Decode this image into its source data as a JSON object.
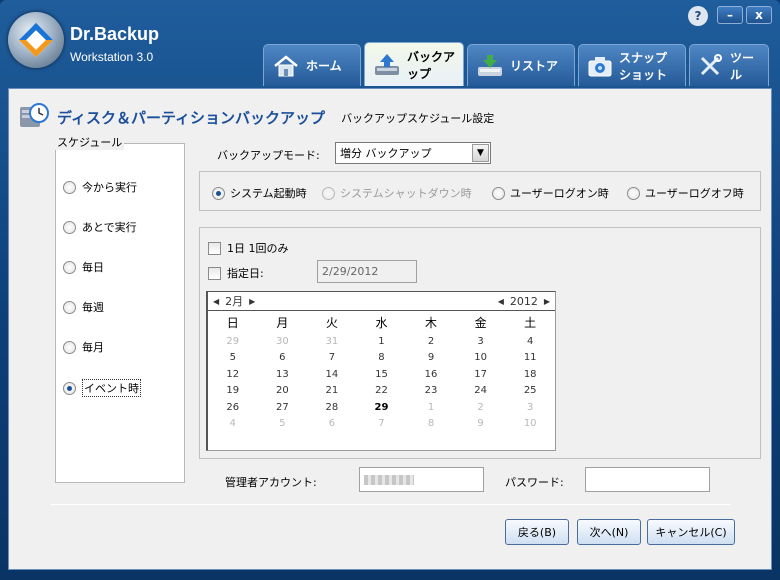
{
  "app": {
    "name": "Dr.Backup",
    "edition": "Workstation 3.0"
  },
  "window_controls": {
    "help": "?",
    "minimize": "–",
    "close": "x"
  },
  "tabs": [
    {
      "label": "ホーム",
      "icon": "house-icon"
    },
    {
      "label": "バックアップ",
      "icon": "backup-upload-icon",
      "active": true
    },
    {
      "label": "リストア",
      "icon": "restore-download-icon"
    },
    {
      "label": "スナップショット",
      "icon": "camera-icon"
    },
    {
      "label": "ツール",
      "icon": "tools-icon"
    }
  ],
  "page": {
    "title": "ディスク＆パーティションバックアップ",
    "subtitle": "バックアップスケジュール設定"
  },
  "schedule": {
    "group_label": "スケジュール",
    "options": [
      "今から実行",
      "あとで実行",
      "毎日",
      "毎週",
      "毎月",
      "イベント時"
    ],
    "selected": "イベント時"
  },
  "backup_mode": {
    "label": "バックアップモード:",
    "value": "増分 バックアップ"
  },
  "events": {
    "options": [
      "システム起動時",
      "システムシャットダウン時",
      "ユーザーログオン時",
      "ユーザーログオフ時"
    ],
    "selected": "システム起動時",
    "disabled": "システムシャットダウン時"
  },
  "date_options": {
    "once_per_day": "1日 1回のみ",
    "specified_date_label": "指定日:",
    "specified_date_value": "2/29/2012"
  },
  "calendar": {
    "month": "2月",
    "year": "2012",
    "weekdays": [
      "日",
      "月",
      "火",
      "水",
      "木",
      "金",
      "土"
    ],
    "weeks": [
      [
        "29",
        "30",
        "31",
        "1",
        "2",
        "3",
        "4"
      ],
      [
        "5",
        "6",
        "7",
        "8",
        "9",
        "10",
        "11"
      ],
      [
        "12",
        "13",
        "14",
        "15",
        "16",
        "17",
        "18"
      ],
      [
        "19",
        "20",
        "21",
        "22",
        "23",
        "24",
        "25"
      ],
      [
        "26",
        "27",
        "28",
        "29",
        "1",
        "2",
        "3"
      ],
      [
        "4",
        "5",
        "6",
        "7",
        "8",
        "9",
        "10"
      ]
    ],
    "selected_day": "29"
  },
  "credentials": {
    "admin_label": "管理者アカウント:",
    "password_label": "パスワード:"
  },
  "buttons": {
    "back": "戻る(B)",
    "next": "次へ(N)",
    "cancel": "キャンセル(C)"
  }
}
